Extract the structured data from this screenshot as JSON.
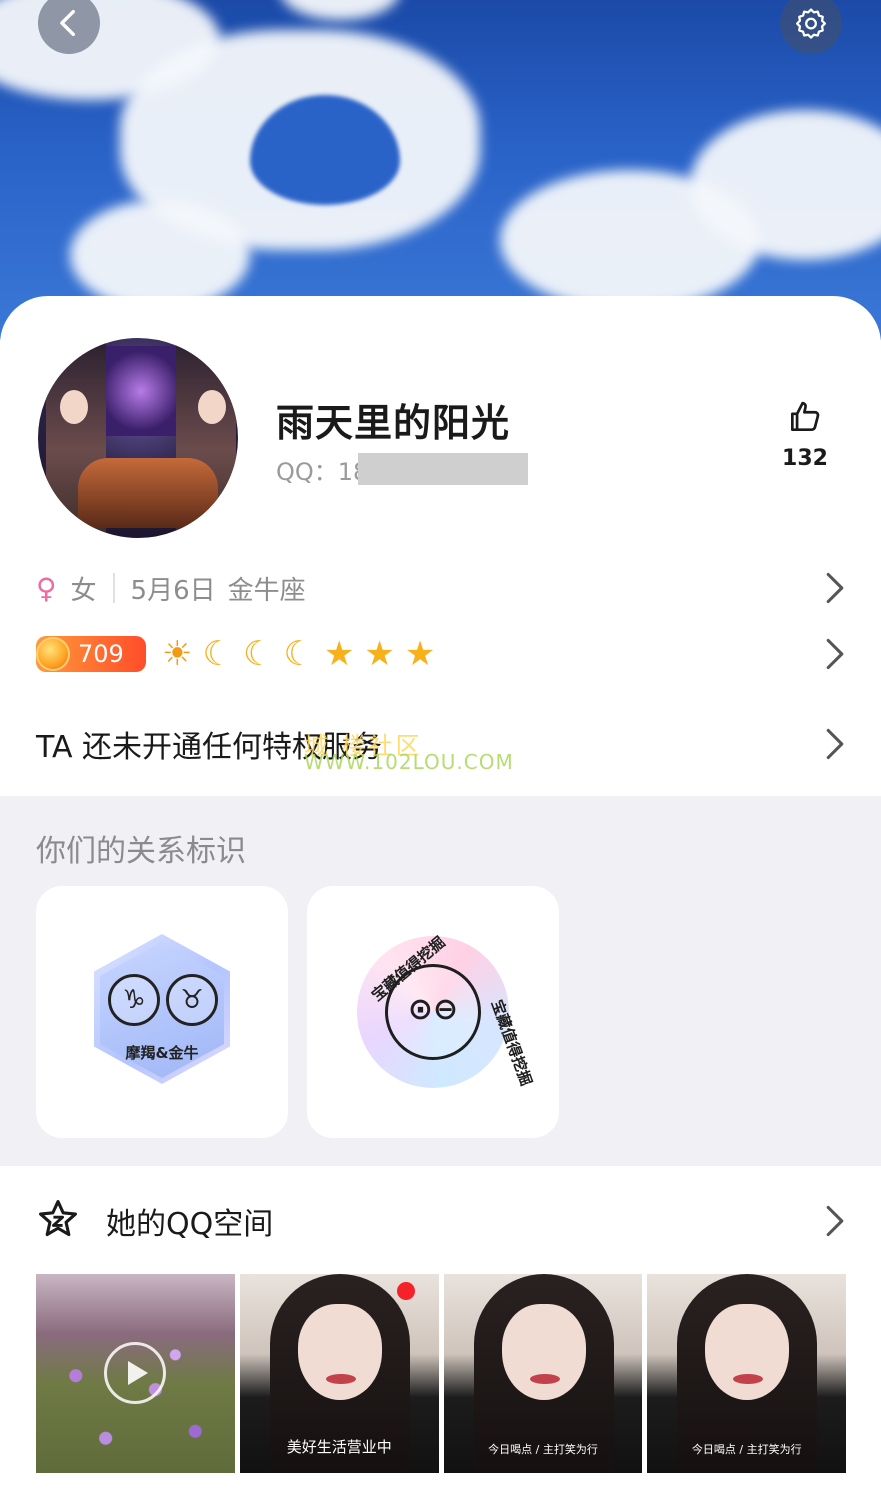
{
  "header": {
    "back_icon": "chevron-left-icon",
    "settings_icon": "gear-icon"
  },
  "profile": {
    "name": "雨天里的阳光",
    "qq_label": "QQ：18",
    "likes": "132",
    "gender_symbol": "♀",
    "gender": "女",
    "birthday": "5月6日",
    "constellation": "金牛座",
    "level_number": "709",
    "level_icons": [
      "☀",
      "☾",
      "☾",
      "☾",
      "★",
      "★",
      "★"
    ]
  },
  "privilege": {
    "text": "TA 还未开通任何特权服务"
  },
  "watermark": {
    "line1": "城 楼社区",
    "line2": "WWW.102LOU.COM"
  },
  "relations": {
    "title": "你们的关系标识",
    "badge1": {
      "symbols": [
        "♑",
        "♉"
      ],
      "label": "摩羯&金牛"
    },
    "badge2": {
      "face": "⊙⊖",
      "ring_text_top": "宝藏值得挖掘",
      "ring_text_bottom": "宝藏值得挖掘"
    }
  },
  "zone": {
    "title": "她的QQ空间",
    "thumbs": [
      {
        "type": "video",
        "caption": ""
      },
      {
        "type": "photo",
        "caption": "美好生活营业中"
      },
      {
        "type": "photo",
        "caption": "今日喝点 / 主打笑为行"
      },
      {
        "type": "photo",
        "caption": "今日喝点 / 主打笑为行"
      }
    ]
  },
  "colors": {
    "accent_pink": "#f06aa2",
    "level_orange": "#ff5a2a",
    "star_gold": "#f7b11b",
    "section_bg": "#f0f0f5"
  }
}
